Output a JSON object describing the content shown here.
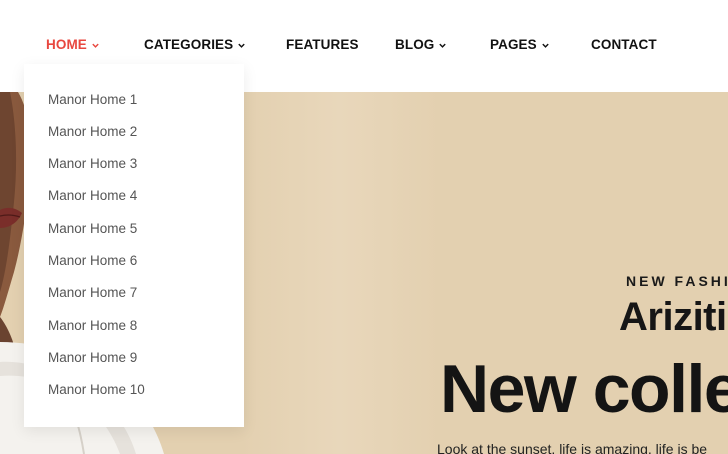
{
  "nav": {
    "items": [
      {
        "label": "HOME",
        "active": true,
        "dropdown": true
      },
      {
        "label": "CATEGORIES",
        "dropdown": true
      },
      {
        "label": "FEATURES",
        "dropdown": false
      },
      {
        "label": "BLOG",
        "dropdown": true
      },
      {
        "label": "PAGES",
        "dropdown": true
      },
      {
        "label": "CONTACT",
        "dropdown": false
      }
    ]
  },
  "dropdown": {
    "items": [
      "Manor Home 1",
      "Manor Home 2",
      "Manor Home 3",
      "Manor Home 4",
      "Manor Home 5",
      "Manor Home 6",
      "Manor Home 7",
      "Manor Home 8",
      "Manor Home 9",
      "Manor Home 10"
    ]
  },
  "hero": {
    "eyebrow": "NEW FASHIC",
    "brand": "Ariziti",
    "title": "New colle",
    "description": "Look at the sunset, life is amazing, life is be"
  },
  "colors": {
    "accent": "#e8473f",
    "hero_background": "#e3d0b0",
    "text": "#111111"
  },
  "icons": [
    "chevron-down-icon"
  ]
}
